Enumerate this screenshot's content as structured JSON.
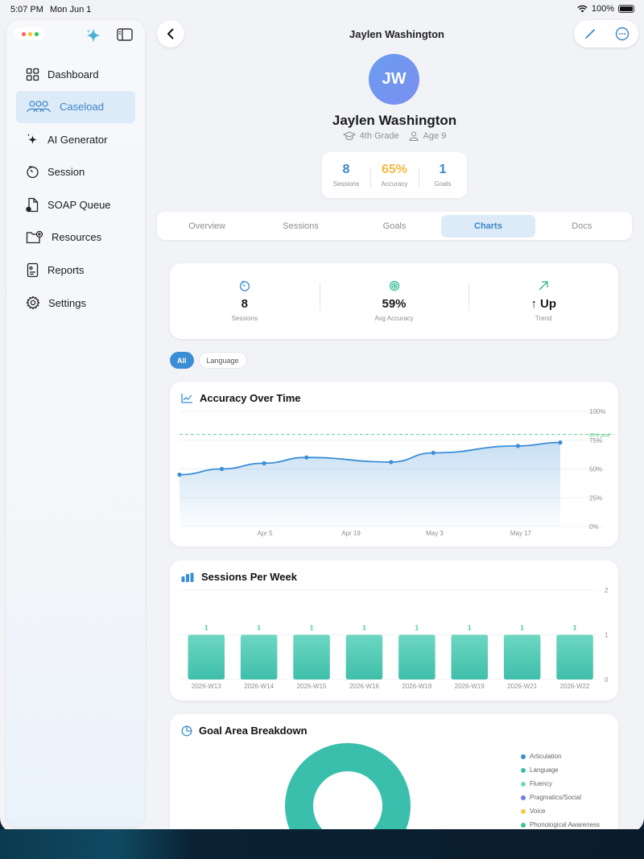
{
  "status_bar": {
    "time": "5:07 PM",
    "date": "Mon Jun 1",
    "battery": "100%"
  },
  "sidebar": {
    "items": [
      {
        "label": "Dashboard",
        "icon": "grid-icon"
      },
      {
        "label": "Caseload",
        "icon": "people-icon",
        "active": true
      },
      {
        "label": "AI Generator",
        "icon": "sparkle-icon"
      },
      {
        "label": "Session",
        "icon": "timer-icon"
      },
      {
        "label": "SOAP Queue",
        "icon": "document-icon"
      },
      {
        "label": "Resources",
        "icon": "folder-plus-icon"
      },
      {
        "label": "Reports",
        "icon": "report-icon"
      },
      {
        "label": "Settings",
        "icon": "gear-icon"
      }
    ]
  },
  "header": {
    "title": "Jaylen Washington"
  },
  "profile": {
    "initials": "JW",
    "name": "Jaylen Washington",
    "grade": "4th Grade",
    "age": "Age 9",
    "stats": [
      {
        "value": "8",
        "label": "Sessions",
        "color": "#3a86c9"
      },
      {
        "value": "65%",
        "label": "Accuracy",
        "color": "#f5b942"
      },
      {
        "value": "1",
        "label": "Goals",
        "color": "#3a86c9"
      }
    ]
  },
  "tabs": [
    "Overview",
    "Sessions",
    "Goals",
    "Charts",
    "Docs"
  ],
  "active_tab": "Charts",
  "summary": [
    {
      "value": "8",
      "label": "Sessions",
      "icon": "timer-icon"
    },
    {
      "value": "59%",
      "label": "Avg Accuracy",
      "icon": "target-icon"
    },
    {
      "value": "↑ Up",
      "label": "Trend",
      "icon": "trend-arrow-icon"
    }
  ],
  "filters": [
    "All",
    "Language"
  ],
  "charts": {
    "accuracy_title": "Accuracy Over Time",
    "sessions_title": "Sessions Per Week",
    "goal_title": "Goal Area Breakdown"
  },
  "chart_data": [
    {
      "type": "area",
      "title": "Accuracy Over Time",
      "x_ticks": [
        "Apr 5",
        "Apr 19",
        "May 3",
        "May 17"
      ],
      "y_ticks": [
        "100%",
        "75%",
        "50%",
        "25%",
        "0%"
      ],
      "ylim": [
        0,
        100
      ],
      "x": [
        "Mar 29",
        "Apr 1",
        "Apr 5",
        "Apr 12",
        "Apr 26",
        "May 3",
        "May 17",
        "May 24"
      ],
      "values": [
        45,
        50,
        55,
        60,
        56,
        64,
        70,
        73
      ],
      "goal_line": {
        "value": 80,
        "label": "80% goal"
      },
      "color": "#3a8ed6"
    },
    {
      "type": "bar",
      "title": "Sessions Per Week",
      "categories": [
        "2026-W13",
        "2026-W14",
        "2026-W15",
        "2026-W16",
        "2026-W18",
        "2026-W19",
        "2026-W21",
        "2026-W22"
      ],
      "values": [
        1,
        1,
        1,
        1,
        1,
        1,
        1,
        1
      ],
      "y_ticks": [
        "2",
        "1",
        "0"
      ],
      "ylim": [
        0,
        2
      ],
      "color": "#4ecbb4"
    },
    {
      "type": "pie",
      "title": "Goal Area Breakdown",
      "labels": [
        "Articulation",
        "Language",
        "Fluency",
        "Pragmatics/Social",
        "Voice",
        "Phonological Awareness"
      ],
      "values": [
        0,
        1,
        0,
        0,
        0,
        0
      ],
      "colors": [
        "#3a8ed6",
        "#3bbfad",
        "#6fd8c2",
        "#6b7cf0",
        "#f5c842",
        "#3cc48a"
      ]
    }
  ]
}
